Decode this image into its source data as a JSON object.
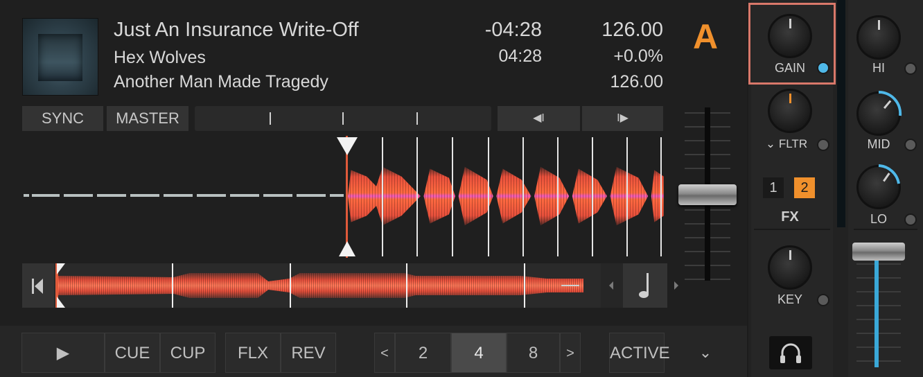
{
  "deck": {
    "letter": "A",
    "track": {
      "title": "Just An Insurance Write-Off",
      "artist": "Hex Wolves",
      "album": "Another Man Made Tragedy",
      "remaining_time": "-04:28",
      "total_time": "04:28",
      "bpm": "126.00",
      "pitch": "+0.0%",
      "original_bpm": "126.00"
    },
    "sync_label": "SYNC",
    "master_label": "MASTER",
    "beatjump_back_label": "◀I",
    "beatjump_forward_label": "I▶"
  },
  "transport": {
    "play_label": "▶",
    "cue_label": "CUE",
    "cup_label": "CUP",
    "flx_label": "FLX",
    "rev_label": "REV",
    "prev_label": "<",
    "next_label": ">",
    "loop_sizes": [
      "2",
      "4",
      "8"
    ],
    "active_loop": "4",
    "active_label": "ACTIVE",
    "more_label": "⌄"
  },
  "mixer": {
    "gain_label": "GAIN",
    "filter_label": "⌄ FLTR",
    "fx_label": "FX",
    "fx_units": [
      "1",
      "2"
    ],
    "key_label": "KEY",
    "hi_label": "HI",
    "mid_label": "MID",
    "lo_label": "LO",
    "headphone_icon": "headphones-icon",
    "colors": {
      "accent_orange": "#f0902c",
      "accent_blue": "#4fb8e8",
      "gain_highlight": "#d9786a"
    }
  }
}
